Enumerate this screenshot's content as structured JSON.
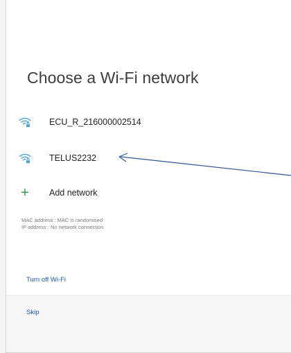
{
  "screen": {
    "title": "Choose a Wi‑Fi network"
  },
  "networks": [
    {
      "ssid": "ECU_R_216000002514",
      "icon": "wifi-lock-icon"
    },
    {
      "ssid": "TELUS2232",
      "icon": "wifi-lock-icon"
    }
  ],
  "add_network": {
    "label": "Add network",
    "icon": "plus-icon"
  },
  "info": {
    "mac": "MAC address : MAC is randomised",
    "ip": "IP address : No network connection"
  },
  "actions": {
    "turn_off_wifi": "Turn off Wi-Fi",
    "skip": "Skip"
  },
  "colors": {
    "wifi_icon": "#4aa3d8",
    "add_icon": "#2e9d4f",
    "link": "#1a56b8",
    "annotation_arrow": "#2f5496"
  }
}
